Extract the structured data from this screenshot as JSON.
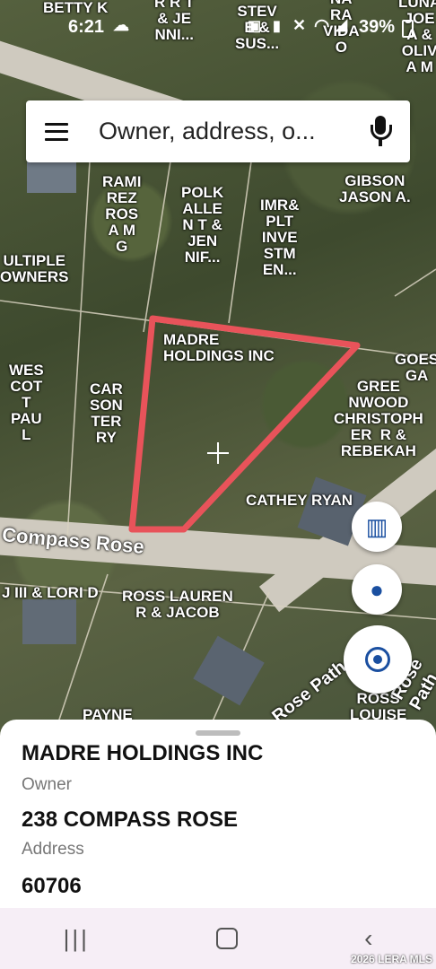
{
  "status_bar": {
    "time": "6:21",
    "battery": "39%"
  },
  "search": {
    "placeholder": "Owner, address, o..."
  },
  "map": {
    "parcel_labels": [
      "BETTY K",
      "R R T\n& JE\nNNI...",
      "STEV\nE &\nSUS...",
      "NA\nRA\nVIDA\nO",
      "LUNA\nJOE\nA &\nOLIV\nA M",
      "RAMI\nREZ\nROS\nA M\nG",
      "POLK\nALLE\nN T &\nJEN\nNIF...",
      "IMR&\nPLT\nINVE\nSTM\nEN...",
      "GIBSON\nJASON A.",
      "ULTIPLE\nOWNERS",
      "MADRE\nHOLDINGS INC",
      "GOES\nGA",
      "WES\nCOT\nT\nPAU\nL",
      "CAR\nSON\nTER\nRY",
      "GREE\nNWOOD\nCHRISTOPH\nER  R &\nREBEKAH",
      "CATHEY RYAN",
      "J III & LORI D",
      "ROSS LAUREN\nR & JACOB",
      "PAYNE",
      "ROSS\nLOUISE"
    ],
    "road_labels": [
      "Compass Rose",
      "Rose Path",
      "Rose Path"
    ],
    "highlight_color": "#e8535a"
  },
  "sheet": {
    "owner_value": "MADRE HOLDINGS INC",
    "owner_label": "Owner",
    "address_value": "238 COMPASS ROSE",
    "address_label": "Address",
    "parcel_id": "60706"
  },
  "watermark": "2026 LERA MLS"
}
